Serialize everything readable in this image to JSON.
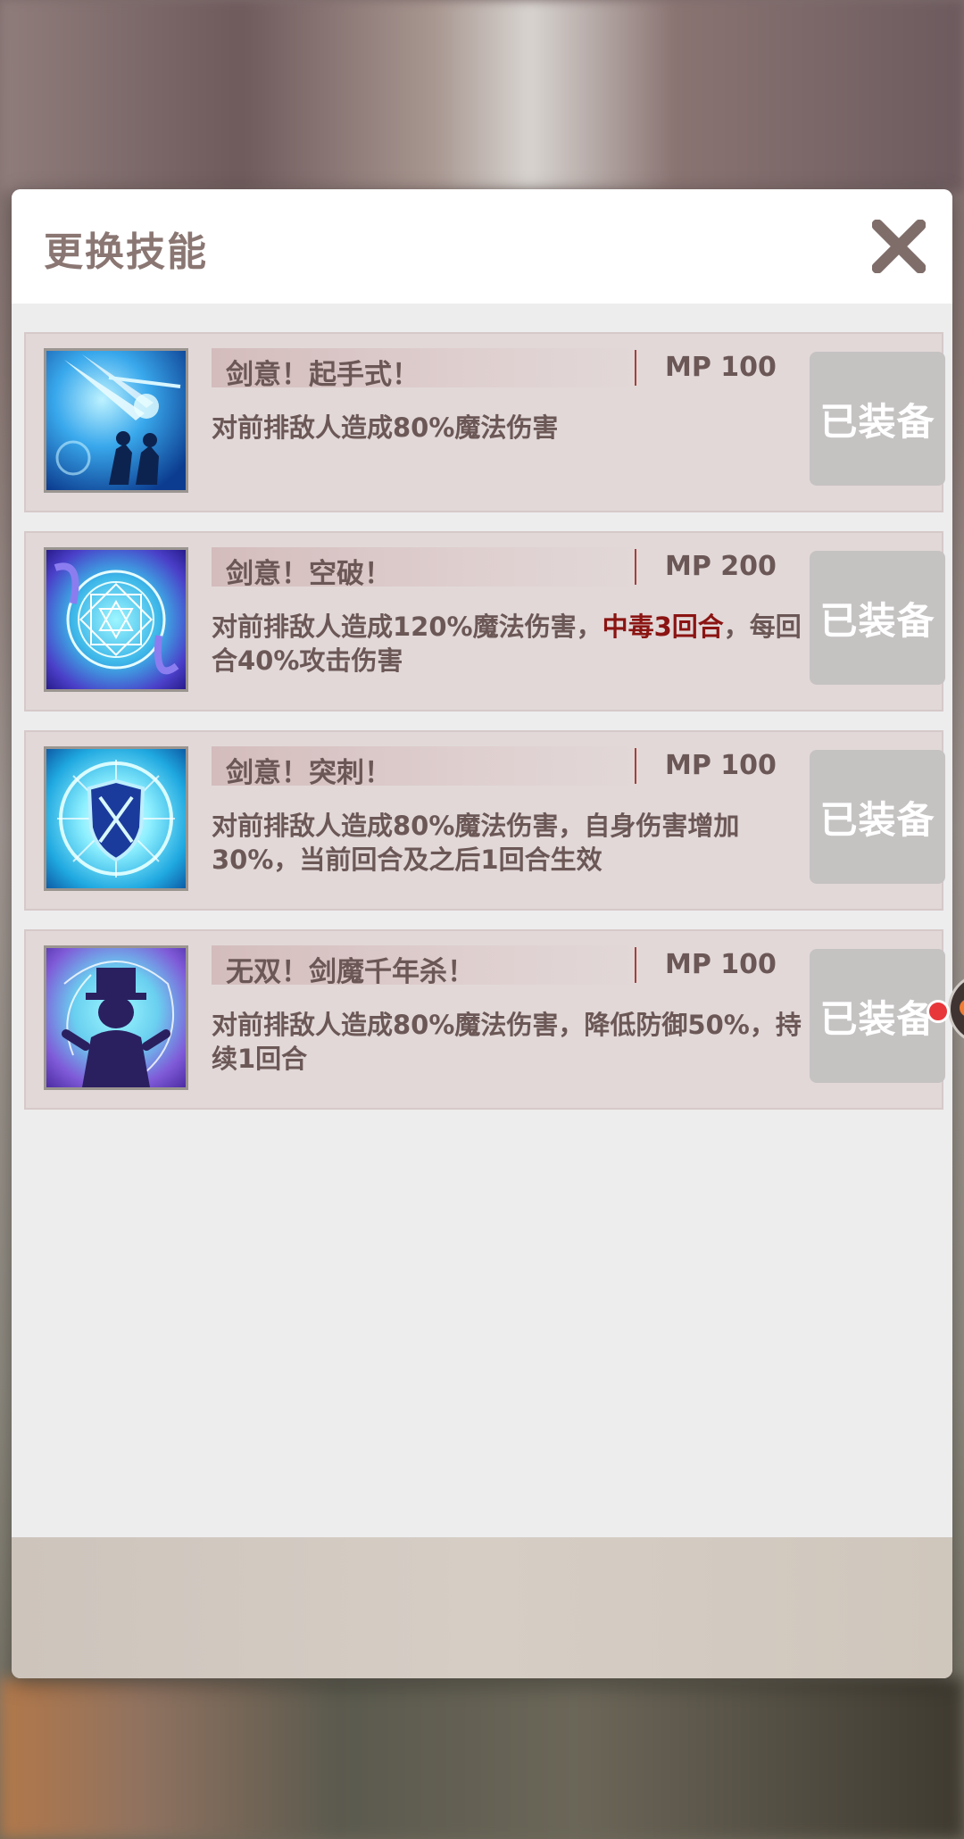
{
  "dialog": {
    "title": "更换技能",
    "close_icon": "close-x-icon"
  },
  "skills": [
    {
      "name": "剑意！起手式！",
      "mp": "MP 100",
      "desc": "对前排敌人造成80%魔法伤害",
      "desc_highlight": "",
      "desc_tail": "",
      "button": "已装备",
      "icon": "sword-slash-silhouettes-icon"
    },
    {
      "name": "剑意！空破！",
      "mp": "MP 200",
      "desc": "对前排敌人造成120%魔法伤害，",
      "desc_highlight": "中毒3回合",
      "desc_tail": "，每回合40%攻击伤害",
      "button": "已装备",
      "icon": "magic-circle-icon"
    },
    {
      "name": "剑意！突刺！",
      "mp": "MP 100",
      "desc": "对前排敌人造成80%魔法伤害，自身伤害增加30%，当前回合及之后1回合生效",
      "desc_highlight": "",
      "desc_tail": "",
      "button": "已装备",
      "icon": "shield-burst-icon"
    },
    {
      "name": "无双！剑魔千年杀！",
      "mp": "MP 100",
      "desc": "对前排敌人造成80%魔法伤害，降低防御50%，持续1回合",
      "desc_highlight": "",
      "desc_tail": "",
      "button": "已装备",
      "icon": "hat-figure-icon"
    }
  ],
  "colors": {
    "highlight": "#8a1412",
    "text": "#6b5856",
    "button_bg": "#c5c2c2",
    "notification_dot": "#e8373b"
  }
}
